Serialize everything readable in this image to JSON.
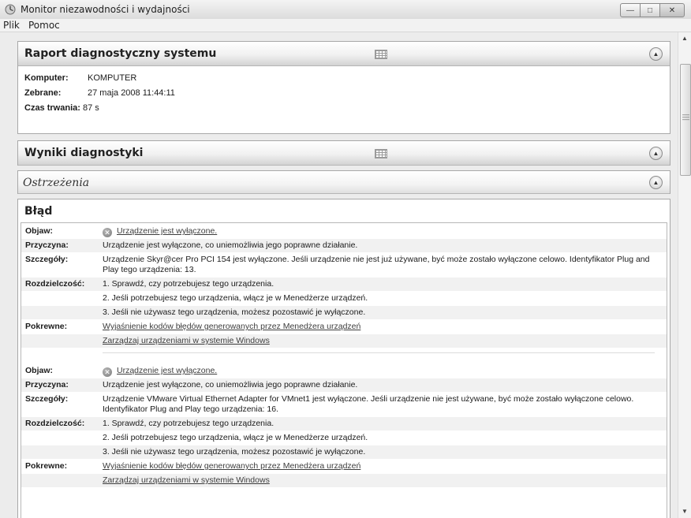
{
  "window": {
    "title": "Monitor niezawodności i wydajności"
  },
  "menu": [
    "Plik",
    "Pomoc"
  ],
  "report": {
    "title": "Raport diagnostyczny systemu",
    "fields": [
      {
        "label": "Komputer:",
        "value": "KOMPUTER"
      },
      {
        "label": "Zebrane:",
        "value": "27 maja 2008 11:44:11"
      },
      {
        "label": "Czas trwania:",
        "value": "87 s"
      }
    ]
  },
  "results": {
    "title": "Wyniki diagnostyki"
  },
  "warnings": {
    "title": "Ostrzeżenia"
  },
  "error": {
    "title": "Błąd",
    "entries": [
      {
        "symptom_label": "Objaw:",
        "symptom": "Urządzenie jest wyłączone.",
        "cause_label": "Przyczyna:",
        "cause": "Urządzenie jest wyłączone, co uniemożliwia jego poprawne działanie.",
        "details_label": "Szczegóły:",
        "details": "Urządzenie Skyr@cer Pro PCI 154 jest wyłączone. Jeśli urządzenie nie jest już używane, być może zostało wyłączone celowo. Identyfikator Plug and Play tego urządzenia: 13.",
        "resolution_label": "Rozdzielczość:",
        "resolution": [
          "1. Sprawdź, czy potrzebujesz tego urządzenia.",
          "2. Jeśli potrzebujesz tego urządzenia, włącz je w Menedżerze urządzeń.",
          "3. Jeśli nie używasz tego urządzenia, możesz pozostawić je wyłączone."
        ],
        "related_label": "Pokrewne:",
        "related": [
          "Wyjaśnienie kodów błędów generowanych przez Menedżera urządzeń",
          "Zarządzaj urządzeniami w systemie Windows"
        ]
      },
      {
        "symptom_label": "Objaw:",
        "symptom": "Urządzenie jest wyłączone.",
        "cause_label": "Przyczyna:",
        "cause": "Urządzenie jest wyłączone, co uniemożliwia jego poprawne działanie.",
        "details_label": "Szczegóły:",
        "details": "Urządzenie VMware Virtual Ethernet Adapter for VMnet1 jest wyłączone. Jeśli urządzenie nie jest używane, być może zostało wyłączone celowo. Identyfikator Plug and Play tego urządzenia: 16.",
        "resolution_label": "Rozdzielczość:",
        "resolution": [
          "1. Sprawdź, czy potrzebujesz tego urządzenia.",
          "2. Jeśli potrzebujesz tego urządzenia, włącz je w Menedżerze urządzeń.",
          "3. Jeśli nie używasz tego urządzenia, możesz pozostawić je wyłączone."
        ],
        "related_label": "Pokrewne:",
        "related": [
          "Wyjaśnienie kodów błędów generowanych przez Menedżera urządzeń",
          "Zarządzaj urządzeniami w systemie Windows"
        ]
      }
    ]
  },
  "icons": {
    "app": "monitor-app-icon",
    "error": "error-x-icon",
    "table": "table-view-icon",
    "collapse": "collapse-up-icon"
  }
}
